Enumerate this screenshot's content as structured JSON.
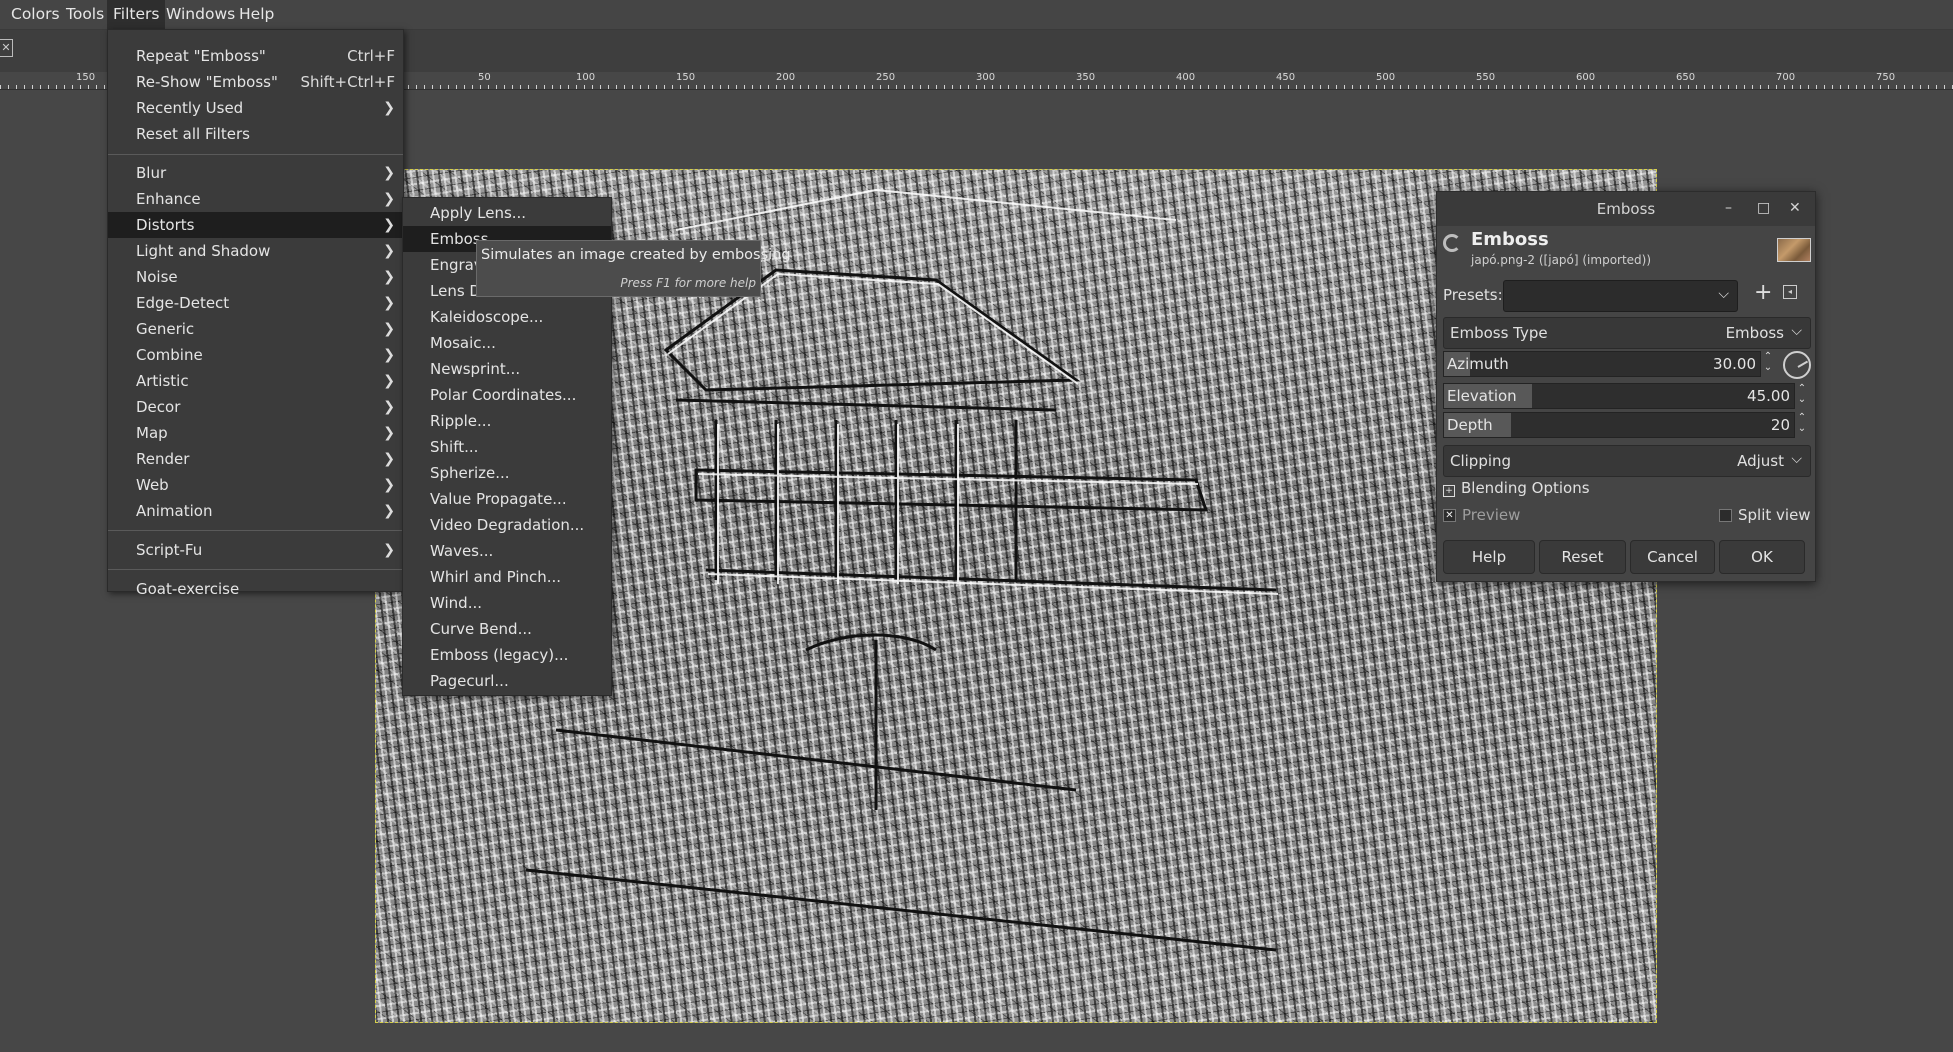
{
  "menubar": {
    "items": [
      {
        "label": "Colors",
        "active": false
      },
      {
        "label": "Tools",
        "active": false
      },
      {
        "label": "Filters",
        "active": true
      },
      {
        "label": "Windows",
        "active": false
      },
      {
        "label": "Help",
        "active": false
      }
    ]
  },
  "ruler": {
    "labels": [
      "150",
      "50",
      "100",
      "150",
      "200",
      "250",
      "300",
      "350",
      "400",
      "450",
      "500",
      "550",
      "600",
      "650",
      "700",
      "750"
    ]
  },
  "filters_menu": {
    "items": [
      {
        "label": "Repeat \"Emboss\"",
        "accel": "Ctrl+F"
      },
      {
        "label": "Re-Show \"Emboss\"",
        "accel": "Shift+Ctrl+F"
      },
      {
        "label": "Recently Used",
        "submenu": true
      },
      {
        "label": "Reset all Filters"
      },
      {
        "label": "Blur",
        "submenu": true
      },
      {
        "label": "Enhance",
        "submenu": true
      },
      {
        "label": "Distorts",
        "submenu": true,
        "highlighted": true
      },
      {
        "label": "Light and Shadow",
        "submenu": true
      },
      {
        "label": "Noise",
        "submenu": true
      },
      {
        "label": "Edge-Detect",
        "submenu": true
      },
      {
        "label": "Generic",
        "submenu": true
      },
      {
        "label": "Combine",
        "submenu": true
      },
      {
        "label": "Artistic",
        "submenu": true
      },
      {
        "label": "Decor",
        "submenu": true
      },
      {
        "label": "Map",
        "submenu": true
      },
      {
        "label": "Render",
        "submenu": true
      },
      {
        "label": "Web",
        "submenu": true
      },
      {
        "label": "Animation",
        "submenu": true
      },
      {
        "label": "Script-Fu",
        "submenu": true
      },
      {
        "label": "Goat-exercise"
      }
    ]
  },
  "distorts_menu": {
    "items": [
      "Apply Lens...",
      "Emboss...",
      "Engrave...",
      "Lens Distortion...",
      "Kaleidoscope...",
      "Mosaic...",
      "Newsprint...",
      "Polar Coordinates...",
      "Ripple...",
      "Shift...",
      "Spherize...",
      "Value Propagate...",
      "Video Degradation...",
      "Waves...",
      "Whirl and Pinch...",
      "Wind...",
      "Curve Bend...",
      "Emboss (legacy)...",
      "Pagecurl..."
    ],
    "visible_labels": [
      "Apply Lens...",
      "Emboss...",
      "Engrave",
      "Lens Di",
      "Kaleidoscope...",
      "Mosaic...",
      "Newsprint...",
      "Polar Coordinates...",
      "Ripple...",
      "Shift...",
      "Spherize...",
      "Value Propagate...",
      "Video Degradation...",
      "Waves...",
      "Whirl and Pinch...",
      "Wind...",
      "Curve Bend...",
      "Emboss (legacy)...",
      "Pagecurl..."
    ],
    "highlighted_index": 1
  },
  "tooltip": {
    "text": "Simulates an image created by embossing",
    "hint": "Press F1 for more help"
  },
  "dialog": {
    "window_title": "Emboss",
    "heading": "Emboss",
    "subtitle": "japó.png-2 ([japó] (imported))",
    "presets_label": "Presets:",
    "presets_value": "",
    "emboss_type_label": "Emboss Type",
    "emboss_type_value": "Emboss",
    "azimuth_label": "Azimuth",
    "azimuth_value": "30.00",
    "azimuth_fraction": 0.083,
    "elevation_label": "Elevation",
    "elevation_value": "45.00",
    "elevation_fraction": 0.25,
    "depth_label": "Depth",
    "depth_value": "20",
    "depth_fraction": 0.19,
    "clipping_label": "Clipping",
    "clipping_value": "Adjust",
    "blending_label": "Blending Options",
    "preview_label": "Preview",
    "split_view_label": "Split view",
    "buttons": {
      "help": "Help",
      "reset": "Reset",
      "cancel": "Cancel",
      "ok": "OK"
    }
  }
}
